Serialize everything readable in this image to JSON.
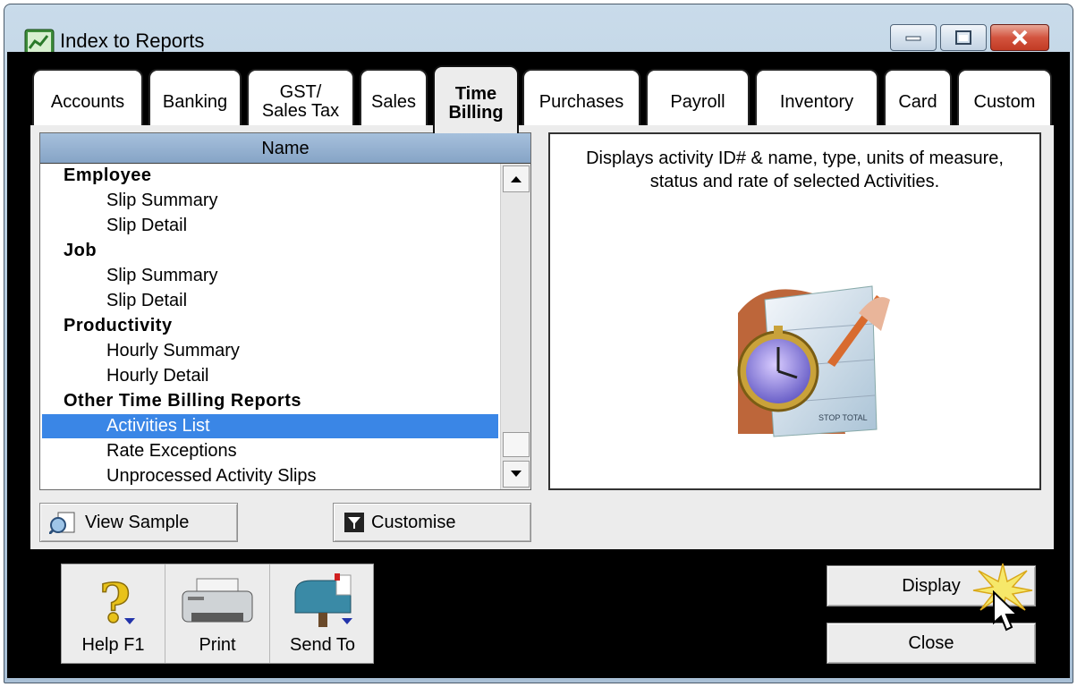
{
  "window": {
    "title": "Index to Reports"
  },
  "tabs": [
    {
      "label": "Accounts",
      "key_index": 5
    },
    {
      "label": "Banking",
      "key_index": 0
    },
    {
      "label_line1": "GST/",
      "label_line2": "Sales Tax"
    },
    {
      "label": "Sales",
      "key_index": 3
    },
    {
      "label_line1": "Time",
      "label_line2": "Billing",
      "active": true
    },
    {
      "label": "Purchases",
      "key_index": 1
    },
    {
      "label": "Payroll",
      "key_index": 2
    },
    {
      "label": "Inventory",
      "key_index": 2
    },
    {
      "label": "Card",
      "key_index": 1
    },
    {
      "label": "Custom",
      "key_index": 4
    }
  ],
  "report_list": {
    "header": "Name",
    "rows": [
      {
        "text": "Employee",
        "type": "group"
      },
      {
        "text": "Slip Summary",
        "type": "item"
      },
      {
        "text": "Slip Detail",
        "type": "item"
      },
      {
        "text": "Job",
        "type": "group"
      },
      {
        "text": "Slip Summary",
        "type": "item"
      },
      {
        "text": "Slip Detail",
        "type": "item"
      },
      {
        "text": "Productivity",
        "type": "group"
      },
      {
        "text": "Hourly Summary",
        "type": "item"
      },
      {
        "text": "Hourly Detail",
        "type": "item"
      },
      {
        "text": "Other Time Billing Reports",
        "type": "group"
      },
      {
        "text": "Activities List",
        "type": "item",
        "selected": true
      },
      {
        "text": "Rate Exceptions",
        "type": "item"
      },
      {
        "text": "Unprocessed Activity Slips",
        "type": "item"
      }
    ]
  },
  "description": {
    "text": "Displays activity ID# & name, type, units of measure, status and rate of selected Activities."
  },
  "buttons": {
    "view_sample": "View Sample",
    "customise": "Customise",
    "display": "Display",
    "close": "Close"
  },
  "toolbar": {
    "help": "Help F1",
    "print": "Print",
    "send_to": "Send To"
  },
  "colors": {
    "selection": "#3a86e6",
    "list_header": "#97b3d3",
    "frame": "#000000",
    "close_button": "#c23b24"
  }
}
